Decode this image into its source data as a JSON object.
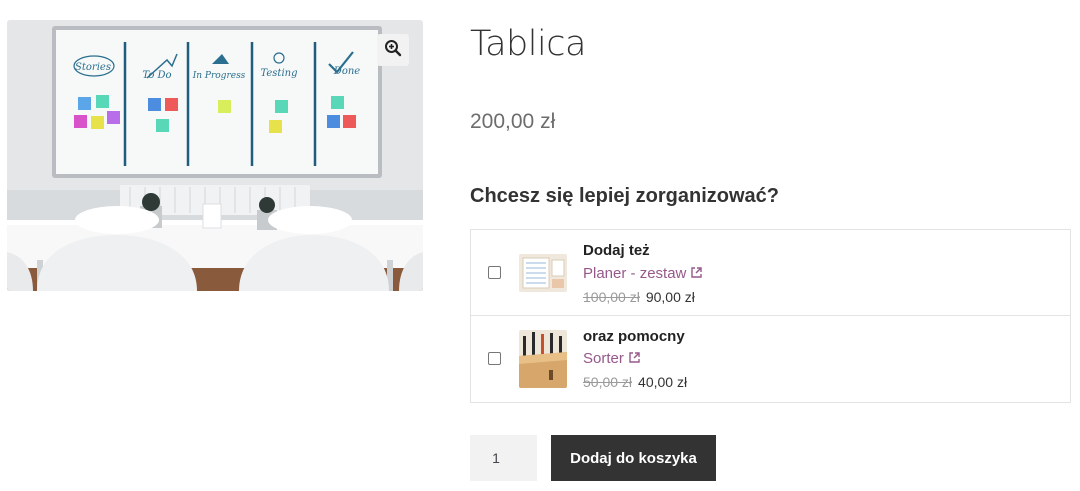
{
  "product": {
    "title": "Tablica",
    "price": "200,00 zł",
    "image": {
      "board_labels": [
        "Stories",
        "To Do",
        "In Progress",
        "Testing",
        "Done"
      ]
    }
  },
  "upsell": {
    "heading": "Chcesz się lepiej zorganizować?",
    "items": [
      {
        "label": "Dodaj też",
        "link": "Planer - zestaw",
        "old_price": "100,00 zł",
        "price": "90,00 zł",
        "checked": false
      },
      {
        "label": "oraz pomocny",
        "link": "Sorter",
        "old_price": "50,00 zł",
        "price": "40,00 zł",
        "checked": false
      }
    ]
  },
  "cart": {
    "quantity": "1",
    "add_label": "Dodaj do koszyka"
  },
  "colors": {
    "accent_link": "#96588a",
    "button_bg": "#333333",
    "text": "#333333",
    "muted": "#6d6d6d"
  },
  "icons": {
    "zoom": "zoom-in-icon",
    "external": "external-link-icon"
  }
}
